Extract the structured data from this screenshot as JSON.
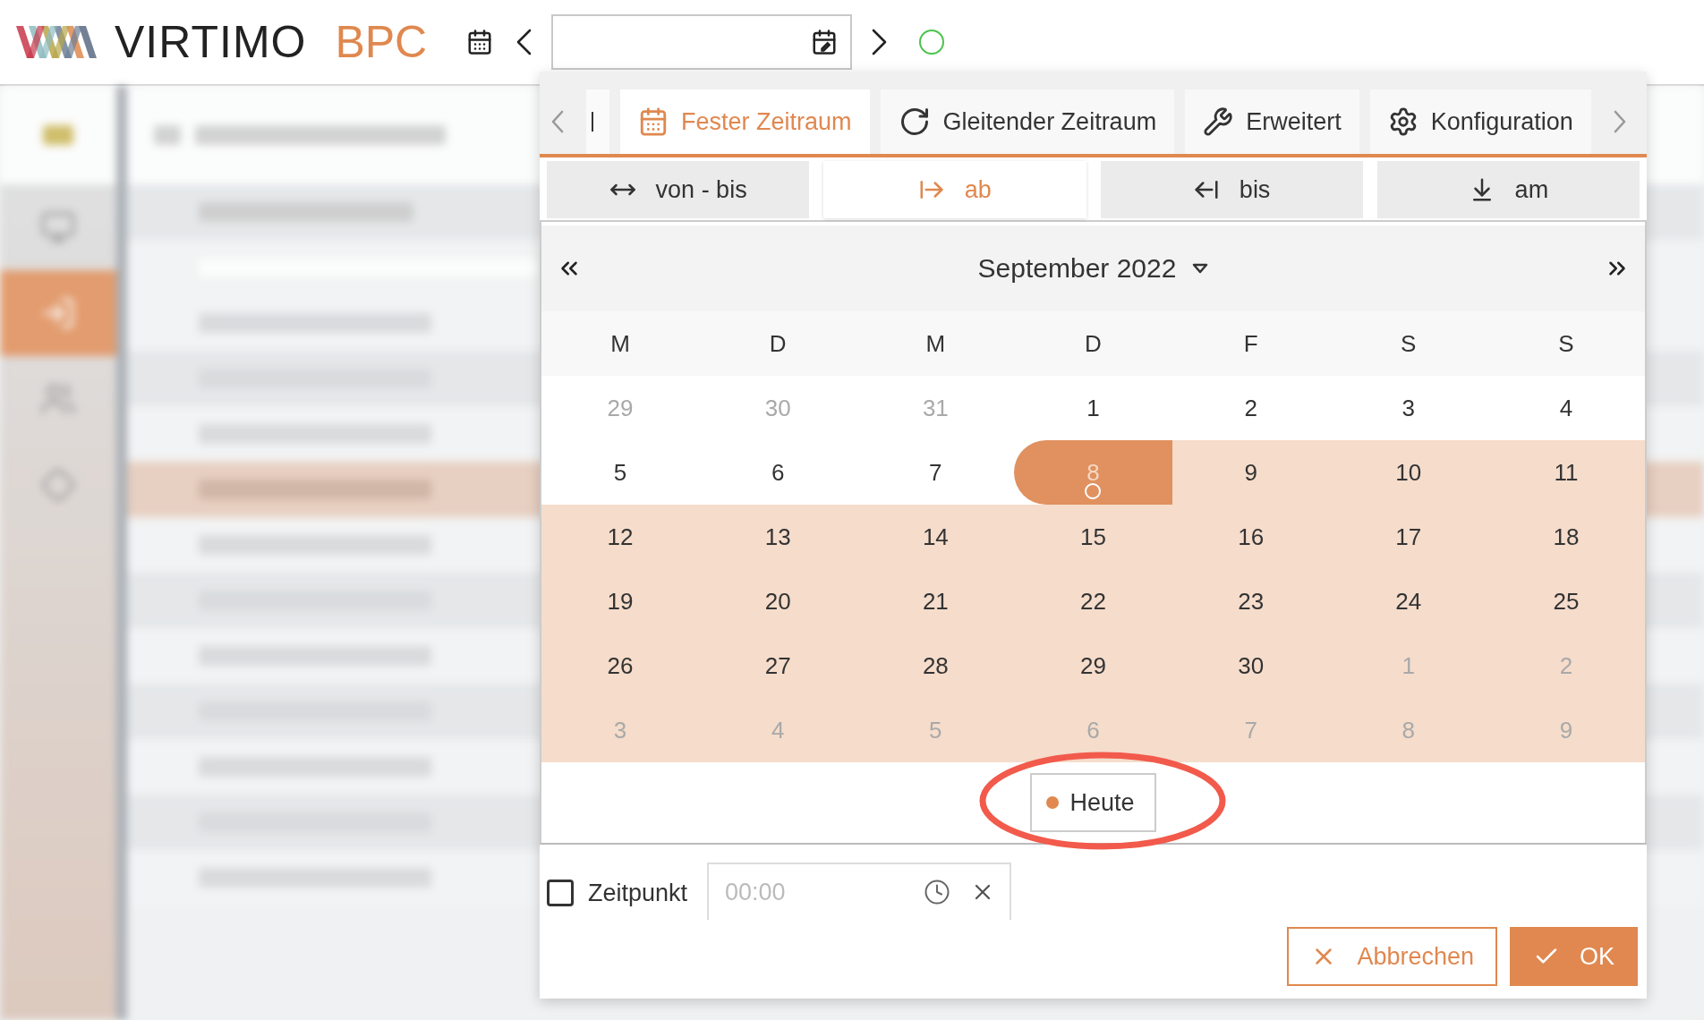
{
  "header": {
    "logo": "VIRTIMO",
    "product": "BPC"
  },
  "sidebar_items": [
    {
      "selected": false
    },
    {
      "selected": true
    },
    {
      "selected": false
    },
    {
      "selected": false
    }
  ],
  "background_rows": [
    {
      "highlighted": false
    },
    {
      "highlighted": false
    },
    {
      "highlighted": false
    },
    {
      "highlighted": true
    },
    {
      "highlighted": false
    },
    {
      "highlighted": false
    },
    {
      "highlighted": false
    },
    {
      "highlighted": false
    },
    {
      "highlighted": false
    },
    {
      "highlighted": false
    },
    {
      "highlighted": false
    }
  ],
  "picker": {
    "tabs": [
      {
        "label": "Fester Zeitraum",
        "kind": "calendar",
        "selected": true
      },
      {
        "label": "Gleitender Zeitraum",
        "kind": "refresh",
        "selected": false
      },
      {
        "label": "Erweitert",
        "kind": "tools",
        "selected": false
      },
      {
        "label": "Konfiguration",
        "kind": "gear",
        "selected": false
      }
    ],
    "modes": [
      {
        "label": "von - bis",
        "kind": "range",
        "selected": false
      },
      {
        "label": "ab",
        "kind": "from",
        "selected": true
      },
      {
        "label": "bis",
        "kind": "until",
        "selected": false
      },
      {
        "label": "am",
        "kind": "on",
        "selected": false
      }
    ],
    "month_label": "September 2022",
    "weekdays": [
      "M",
      "D",
      "M",
      "D",
      "F",
      "S",
      "S"
    ],
    "weeks": [
      [
        {
          "label": "29",
          "other_month": true,
          "in_range": false,
          "selected": false,
          "today": false
        },
        {
          "label": "30",
          "other_month": true,
          "in_range": false,
          "selected": false,
          "today": false
        },
        {
          "label": "31",
          "other_month": true,
          "in_range": false,
          "selected": false,
          "today": false
        },
        {
          "label": "1",
          "other_month": false,
          "in_range": false,
          "selected": false,
          "today": false
        },
        {
          "label": "2",
          "other_month": false,
          "in_range": false,
          "selected": false,
          "today": false
        },
        {
          "label": "3",
          "other_month": false,
          "in_range": false,
          "selected": false,
          "today": false
        },
        {
          "label": "4",
          "other_month": false,
          "in_range": false,
          "selected": false,
          "today": false
        }
      ],
      [
        {
          "label": "5",
          "other_month": false,
          "in_range": false,
          "selected": false,
          "today": false
        },
        {
          "label": "6",
          "other_month": false,
          "in_range": false,
          "selected": false,
          "today": false
        },
        {
          "label": "7",
          "other_month": false,
          "in_range": false,
          "selected": false,
          "today": false
        },
        {
          "label": "8",
          "other_month": false,
          "in_range": true,
          "selected": true,
          "today": true
        },
        {
          "label": "9",
          "other_month": false,
          "in_range": true,
          "selected": false,
          "today": false
        },
        {
          "label": "10",
          "other_month": false,
          "in_range": true,
          "selected": false,
          "today": false
        },
        {
          "label": "11",
          "other_month": false,
          "in_range": true,
          "selected": false,
          "today": false
        }
      ],
      [
        {
          "label": "12",
          "other_month": false,
          "in_range": true,
          "selected": false,
          "today": false
        },
        {
          "label": "13",
          "other_month": false,
          "in_range": true,
          "selected": false,
          "today": false
        },
        {
          "label": "14",
          "other_month": false,
          "in_range": true,
          "selected": false,
          "today": false
        },
        {
          "label": "15",
          "other_month": false,
          "in_range": true,
          "selected": false,
          "today": false
        },
        {
          "label": "16",
          "other_month": false,
          "in_range": true,
          "selected": false,
          "today": false
        },
        {
          "label": "17",
          "other_month": false,
          "in_range": true,
          "selected": false,
          "today": false
        },
        {
          "label": "18",
          "other_month": false,
          "in_range": true,
          "selected": false,
          "today": false
        }
      ],
      [
        {
          "label": "19",
          "other_month": false,
          "in_range": true,
          "selected": false,
          "today": false
        },
        {
          "label": "20",
          "other_month": false,
          "in_range": true,
          "selected": false,
          "today": false
        },
        {
          "label": "21",
          "other_month": false,
          "in_range": true,
          "selected": false,
          "today": false
        },
        {
          "label": "22",
          "other_month": false,
          "in_range": true,
          "selected": false,
          "today": false
        },
        {
          "label": "23",
          "other_month": false,
          "in_range": true,
          "selected": false,
          "today": false
        },
        {
          "label": "24",
          "other_month": false,
          "in_range": true,
          "selected": false,
          "today": false
        },
        {
          "label": "25",
          "other_month": false,
          "in_range": true,
          "selected": false,
          "today": false
        }
      ],
      [
        {
          "label": "26",
          "other_month": false,
          "in_range": true,
          "selected": false,
          "today": false
        },
        {
          "label": "27",
          "other_month": false,
          "in_range": true,
          "selected": false,
          "today": false
        },
        {
          "label": "28",
          "other_month": false,
          "in_range": true,
          "selected": false,
          "today": false
        },
        {
          "label": "29",
          "other_month": false,
          "in_range": true,
          "selected": false,
          "today": false
        },
        {
          "label": "30",
          "other_month": false,
          "in_range": true,
          "selected": false,
          "today": false
        },
        {
          "label": "1",
          "other_month": true,
          "in_range": true,
          "selected": false,
          "today": false
        },
        {
          "label": "2",
          "other_month": true,
          "in_range": true,
          "selected": false,
          "today": false
        }
      ],
      [
        {
          "label": "3",
          "other_month": true,
          "in_range": true,
          "selected": false,
          "today": false
        },
        {
          "label": "4",
          "other_month": true,
          "in_range": true,
          "selected": false,
          "today": false
        },
        {
          "label": "5",
          "other_month": true,
          "in_range": true,
          "selected": false,
          "today": false
        },
        {
          "label": "6",
          "other_month": true,
          "in_range": true,
          "selected": false,
          "today": false
        },
        {
          "label": "7",
          "other_month": true,
          "in_range": true,
          "selected": false,
          "today": false
        },
        {
          "label": "8",
          "other_month": true,
          "in_range": true,
          "selected": false,
          "today": false
        },
        {
          "label": "9",
          "other_month": true,
          "in_range": true,
          "selected": false,
          "today": false
        }
      ]
    ],
    "today_button": "Heute",
    "time": {
      "label": "Zeitpunkt",
      "checked": false,
      "placeholder": "00:00"
    },
    "buttons": [
      {
        "label": "Abbrechen",
        "kind": "secondary"
      },
      {
        "label": "OK",
        "kind": "primary"
      }
    ]
  }
}
